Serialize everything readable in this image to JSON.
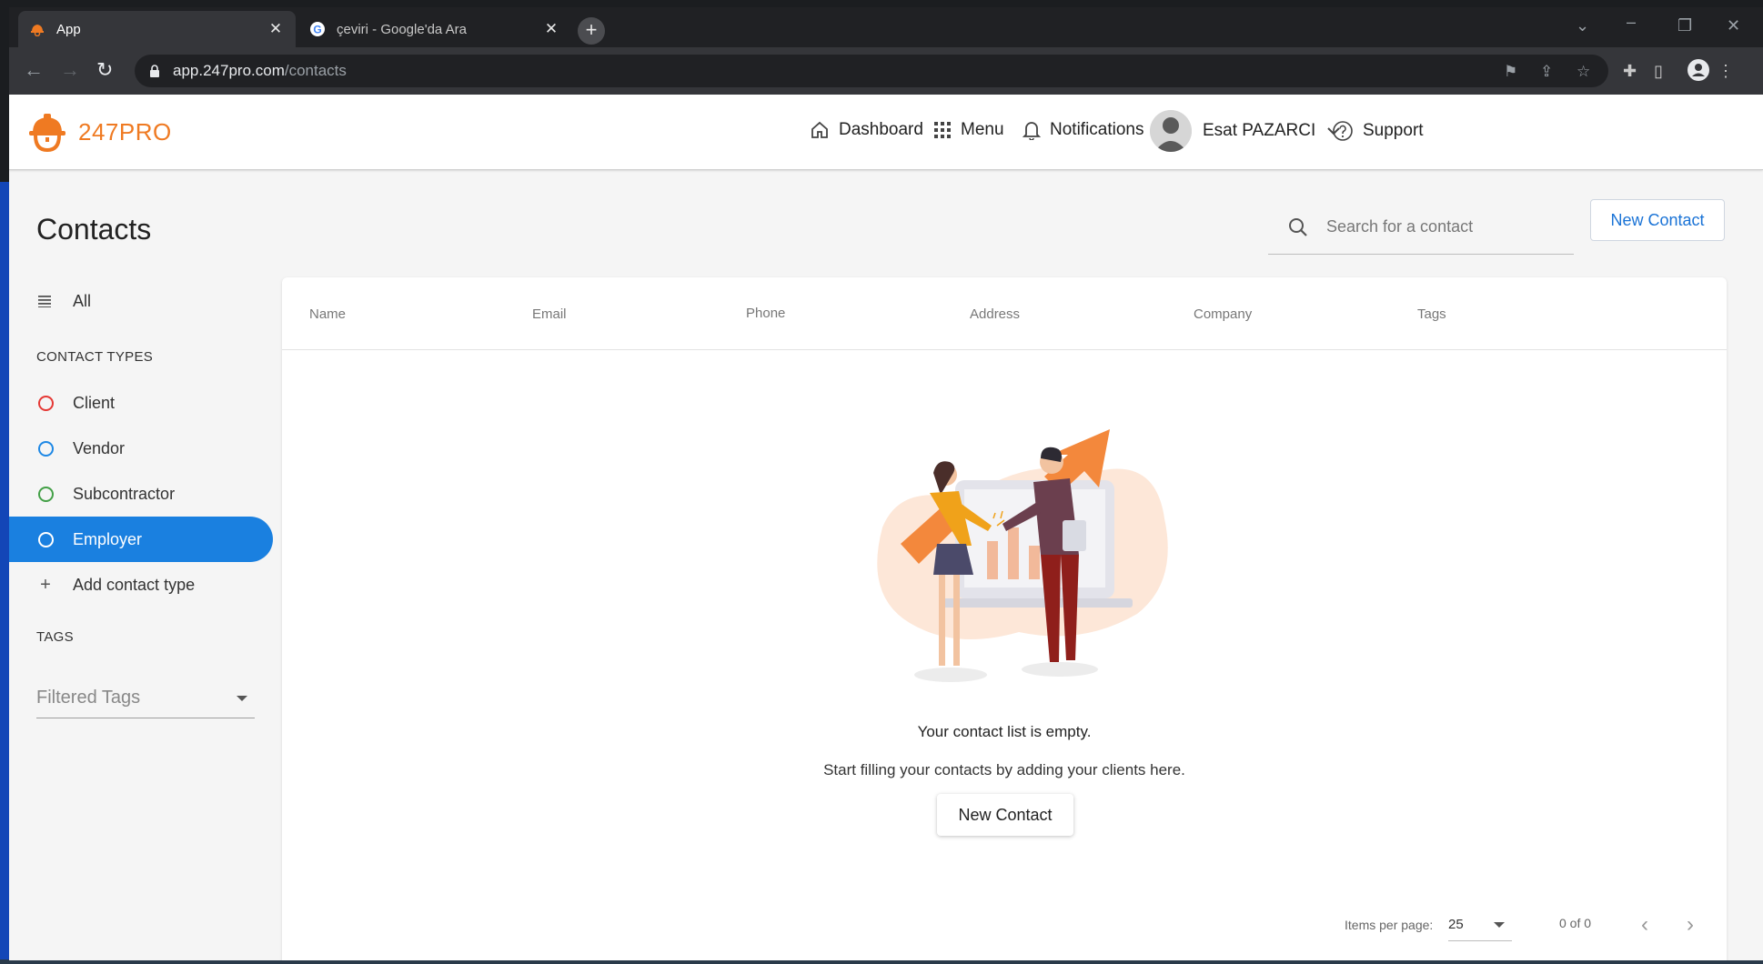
{
  "browser": {
    "tabs": [
      {
        "title": "App",
        "close": "✕"
      },
      {
        "title": "çeviri - Google'da Ara",
        "close": "✕"
      }
    ],
    "new_tab": "+",
    "url_host": "app.247pro.com",
    "url_path": "/contacts"
  },
  "header": {
    "logo_text": "247PRO",
    "nav": {
      "dashboard": "Dashboard",
      "menu": "Menu",
      "notifications": "Notifications",
      "user": "Esat PAZARCI",
      "support": "Support"
    }
  },
  "page": {
    "title": "Contacts",
    "search_placeholder": "Search for a contact",
    "new_contact": "New Contact"
  },
  "sidebar": {
    "all": "All",
    "contact_types_heading": "CONTACT TYPES",
    "types": [
      {
        "label": "Client",
        "color": "#e53935"
      },
      {
        "label": "Vendor",
        "color": "#1e88e5"
      },
      {
        "label": "Subcontractor",
        "color": "#43a047"
      },
      {
        "label": "Employer",
        "color": "#ffffff"
      }
    ],
    "add_type": "Add contact type",
    "tags_heading": "TAGS",
    "tags_placeholder": "Filtered Tags"
  },
  "table": {
    "columns": [
      "Name",
      "Email",
      "Phone",
      "Address",
      "Company",
      "Tags"
    ],
    "empty_title": "Your contact list is empty.",
    "empty_subtitle": "Start filling your contacts by adding your clients here.",
    "empty_button": "New Contact"
  },
  "pagination": {
    "items_per_page_label": "Items per page:",
    "items_per_page": "25",
    "range": "0 of 0"
  },
  "colors": {
    "brand": "#ef7a22",
    "accent": "#1a80e0",
    "link": "#1a73d6"
  }
}
